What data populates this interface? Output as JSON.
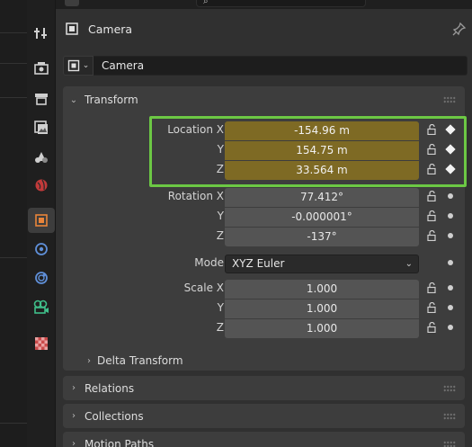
{
  "object": {
    "title": "Camera",
    "name": "Camera",
    "type_icon": "camera-object-icon",
    "pin_icon": "pin-icon"
  },
  "tabs": [
    {
      "name": "tool",
      "icon": "tool-icon"
    },
    {
      "name": "render",
      "icon": "render-icon"
    },
    {
      "name": "output",
      "icon": "output-icon"
    },
    {
      "name": "view-layer",
      "icon": "view-layer-icon"
    },
    {
      "name": "scene",
      "icon": "scene-icon"
    },
    {
      "name": "world",
      "icon": "world-icon"
    },
    {
      "name": "object",
      "icon": "object-icon",
      "active": true
    },
    {
      "name": "modifiers",
      "icon": "modifier-icon"
    },
    {
      "name": "physics",
      "icon": "physics-icon"
    },
    {
      "name": "object-data",
      "icon": "camera-data-icon"
    },
    {
      "name": "texture",
      "icon": "texture-icon"
    }
  ],
  "transform": {
    "header": "Transform",
    "location": {
      "label_x": "Location X",
      "label_y": "Y",
      "label_z": "Z",
      "x": "-154.96 m",
      "y": "154.75 m",
      "z": "33.564 m"
    },
    "rotation": {
      "label_x": "Rotation X",
      "label_y": "Y",
      "label_z": "Z",
      "x": "77.412°",
      "y": "-0.000001°",
      "z": "-137°"
    },
    "mode": {
      "label": "Mode",
      "value": "XYZ Euler"
    },
    "scale": {
      "label_x": "Scale X",
      "label_y": "Y",
      "label_z": "Z",
      "x": "1.000",
      "y": "1.000",
      "z": "1.000"
    },
    "delta": "Delta Transform"
  },
  "panels": {
    "relations": "Relations",
    "collections": "Collections",
    "motion_paths": "Motion Paths"
  },
  "colors": {
    "animated_field": "#7e6a24",
    "highlight_box": "#6cc844",
    "active_tab": "#e8843a"
  }
}
